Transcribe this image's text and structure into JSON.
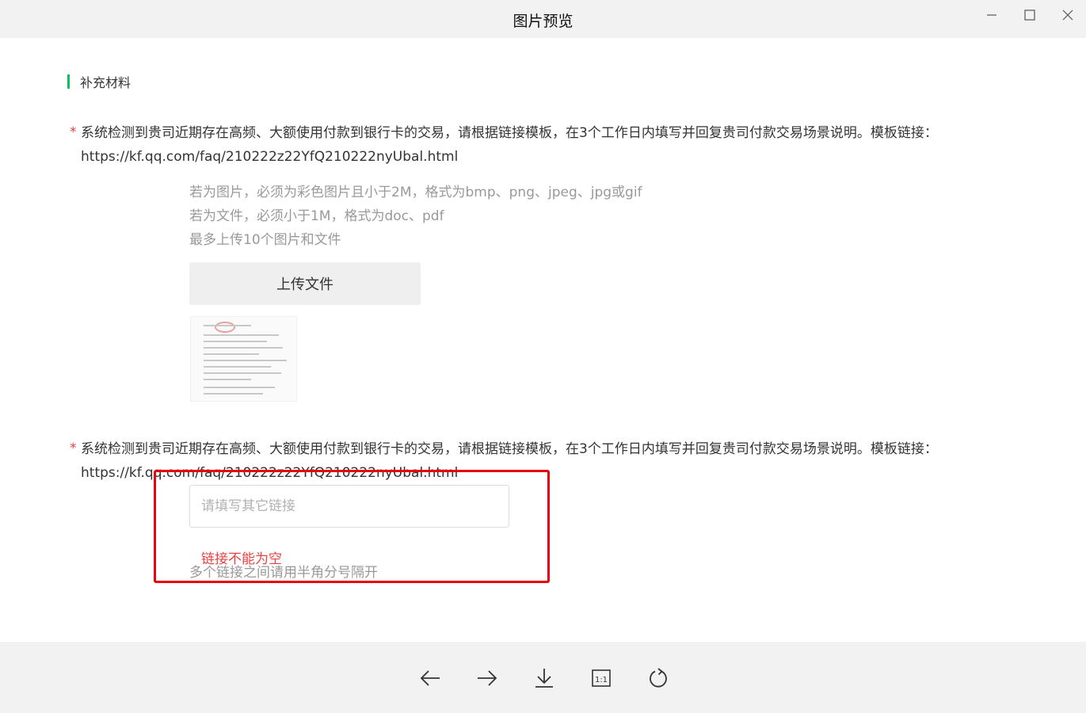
{
  "window": {
    "title": "图片预览"
  },
  "section": {
    "title": "补充材料"
  },
  "question1": {
    "required_mark": "*",
    "text": "系统检测到贵司近期存在高频、大额使用付款到银行卡的交易，请根据链接模板，在3个工作日内填写并回复贵司付款交易场景说明。模板链接：https://kf.qq.com/faq/210222z22YfQ210222nyUbal.html"
  },
  "upload": {
    "hints": [
      "若为图片，必须为彩色图片且小于2M，格式为bmp、png、jpeg、jpg或gif",
      "若为文件，必须小于1M，格式为doc、pdf",
      "最多上传10个图片和文件"
    ],
    "button_label": "上传文件"
  },
  "question2": {
    "required_mark": "*",
    "text": "系统检测到贵司近期存在高频、大额使用付款到银行卡的交易，请根据链接模板，在3个工作日内填写并回复贵司付款交易场景说明。模板链接：https://kf.qq.com/faq/210222z22YfQ210222nyUbal.html"
  },
  "link_field": {
    "placeholder": "请填写其它链接",
    "value": "",
    "error": "链接不能为空",
    "hint": "多个链接之间请用半角分号隔开"
  },
  "colors": {
    "accent": "#07c160",
    "error": "#e64340",
    "annotation": "#e60012"
  },
  "toolbar": {
    "icons": [
      "arrow-left-icon",
      "arrow-right-icon",
      "download-icon",
      "actual-size-icon",
      "rotate-icon"
    ],
    "actual_size_label": "1:1"
  }
}
